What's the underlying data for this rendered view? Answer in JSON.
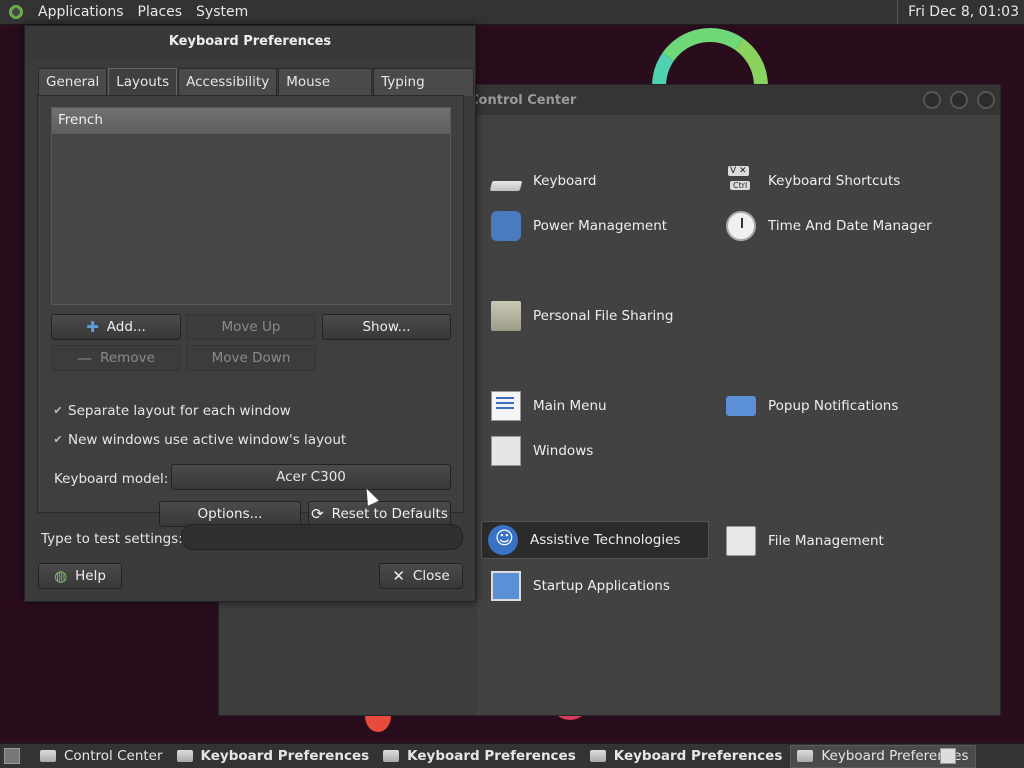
{
  "top_panel": {
    "menus": [
      "Applications",
      "Places",
      "System"
    ],
    "clock": "Fri Dec  8, 01:03"
  },
  "control_center": {
    "title": "Control Center",
    "items": [
      {
        "label": "Keyboard",
        "icon": "keyboard-icon"
      },
      {
        "label": "Keyboard Shortcuts",
        "icon": "keyboard-shortcuts-icon"
      },
      {
        "label": "Power Management",
        "icon": "power-management-icon"
      },
      {
        "label": "Time And Date Manager",
        "icon": "clock-icon"
      },
      {
        "label": "Personal File Sharing",
        "icon": "folder-icon"
      },
      {
        "label": "Main Menu",
        "icon": "main-menu-icon"
      },
      {
        "label": "Popup Notifications",
        "icon": "popup-notifications-icon"
      },
      {
        "label": "Windows",
        "icon": "windows-icon"
      },
      {
        "label": "Assistive Technologies",
        "icon": "accessibility-icon"
      },
      {
        "label": "File Management",
        "icon": "file-management-icon"
      },
      {
        "label": "Startup Applications",
        "icon": "startup-applications-icon"
      }
    ]
  },
  "keyboard_prefs": {
    "title": "Keyboard Preferences",
    "tabs": [
      "General",
      "Layouts",
      "Accessibility",
      "Mouse Keys",
      "Typing Break"
    ],
    "active_tab": "Layouts",
    "layouts": [
      "French"
    ],
    "buttons": {
      "add": "Add...",
      "move_up": "Move Up",
      "show": "Show...",
      "remove": "Remove",
      "move_down": "Move Down",
      "options": "Options...",
      "reset": "Reset to Defaults",
      "help": "Help",
      "close": "Close"
    },
    "checks": {
      "separate_layout": "Separate layout for each window",
      "new_windows": "New windows use active window's layout"
    },
    "model_label": "Keyboard model:",
    "model_value": "Acer C300",
    "test_label": "Type to test settings:",
    "test_value": ""
  },
  "bottom_panel": {
    "tasks": [
      {
        "label": "Control Center",
        "bold": false,
        "active": false
      },
      {
        "label": "Keyboard Preferences",
        "bold": true,
        "active": false
      },
      {
        "label": "Keyboard Preferences",
        "bold": true,
        "active": false
      },
      {
        "label": "Keyboard Preferences",
        "bold": true,
        "active": false
      },
      {
        "label": "Keyboard Preferences",
        "bold": false,
        "active": true
      }
    ]
  }
}
